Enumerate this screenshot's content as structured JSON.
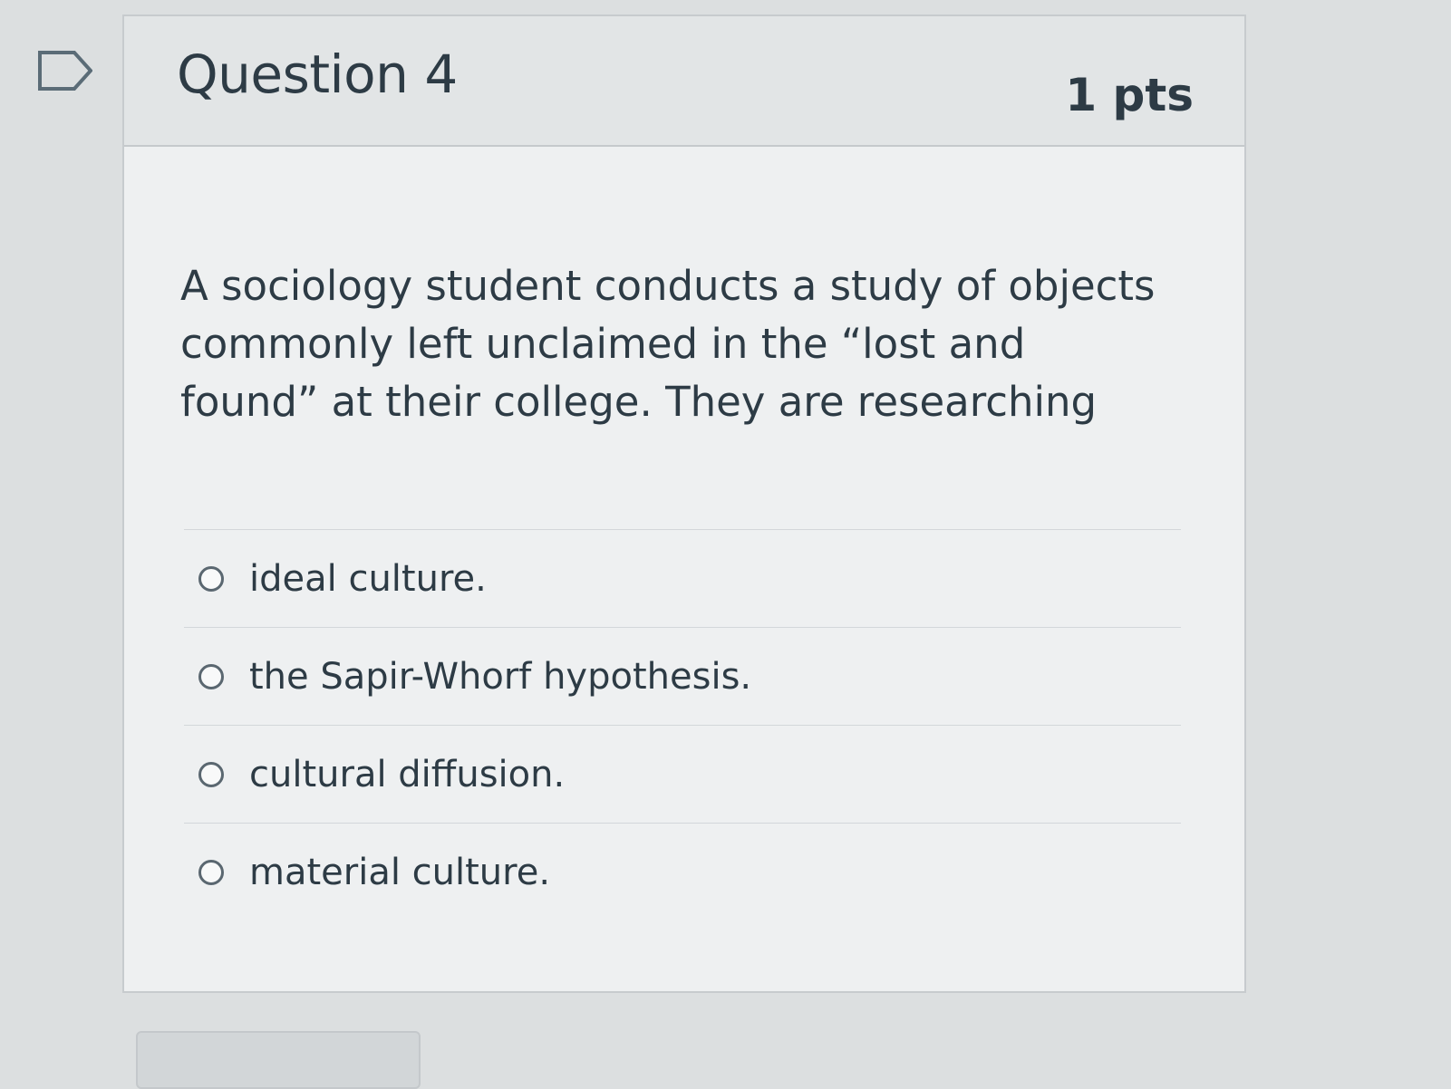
{
  "question": {
    "title": "Question 4",
    "points": "1 pts",
    "text": "A sociology student conducts a study of objects commonly left unclaimed in the “lost and found” at their college. They are researching",
    "answers": [
      "ideal culture.",
      "the Sapir-Whorf hypothesis.",
      "cultural diffusion.",
      "material culture."
    ]
  },
  "icons": {
    "flag": "flag-question-icon",
    "radio": "radio-button-icon"
  },
  "colors": {
    "text": "#2d3b45",
    "header_bg": "#e2e5e6",
    "card_bg": "#eef0f1",
    "flag_outline": "#5b6c77"
  }
}
